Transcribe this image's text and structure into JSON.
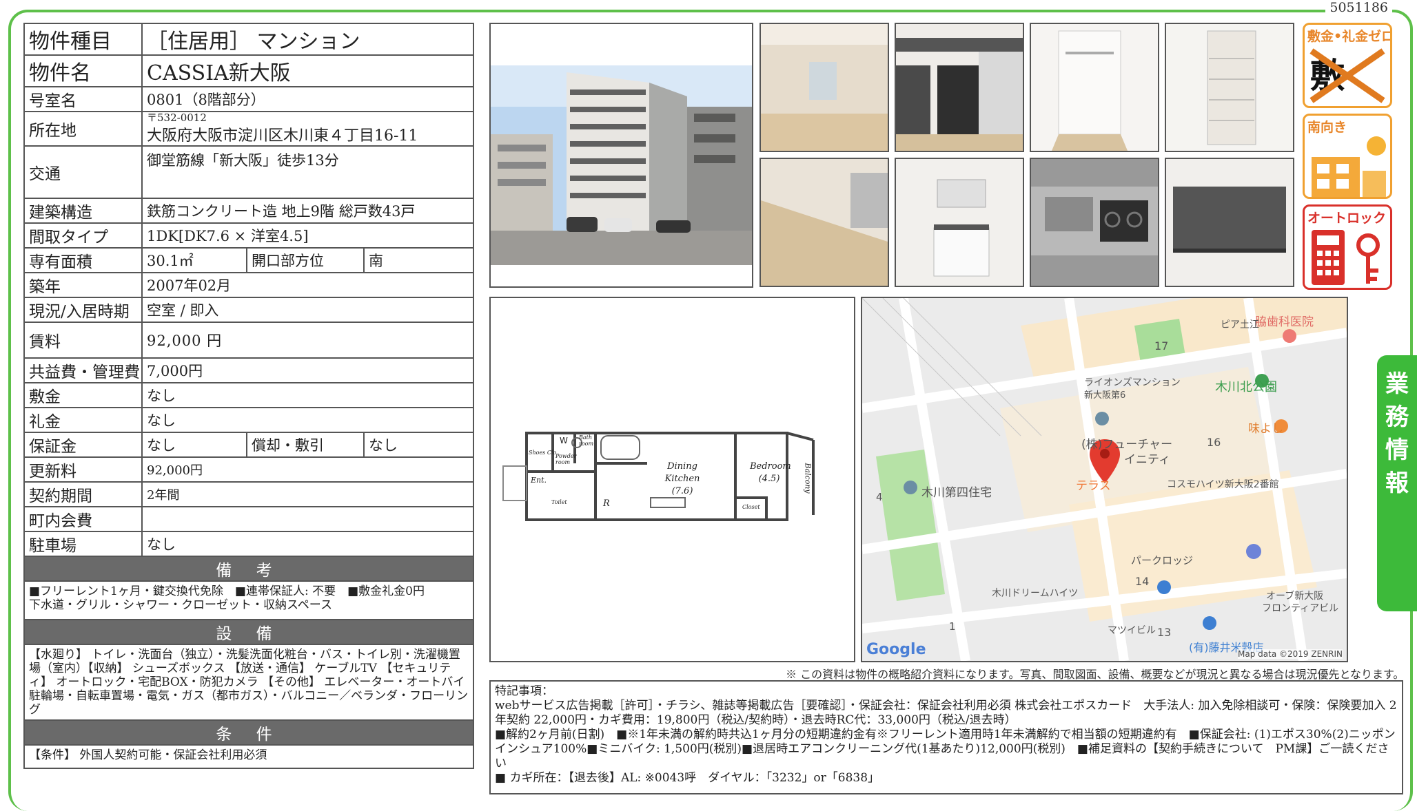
{
  "doc_id": "5051186",
  "spec": {
    "type_label": "物件種目",
    "type_value": "［住居用］ マンション",
    "name_label": "物件名",
    "name_value": "CASSIA新大阪",
    "room_label": "号室名",
    "room_value": "0801（8階部分）",
    "loc_label": "所在地",
    "zip": "〒532-0012",
    "address": "大阪府大阪市淀川区木川東４丁目16-11",
    "access_label": "交通",
    "access_value": "御堂筋線「新大阪」徒歩13分",
    "struct_label": "建築構造",
    "struct_value": "鉄筋コンクリート造 地上9階 総戸数43戸",
    "layout_label": "間取タイプ",
    "layout_value": "1DK[DK7.6 × 洋室4.5]",
    "area_label": "専有面積",
    "area_value": "30.1㎡",
    "dir_label": "開口部方位",
    "dir_value": "南",
    "year_label": "築年",
    "year_value": "2007年02月",
    "status_label": "現況/入居時期",
    "status_value": "空室 / 即入",
    "rent_label": "賃料",
    "rent_value": "92,000 円",
    "fee_label": "共益費・管理費",
    "fee_value": "7,000円",
    "deposit_label": "敷金",
    "deposit_value": "なし",
    "key_label": "礼金",
    "key_value": "なし",
    "guarantee_label": "保証金",
    "guarantee_value": "なし",
    "amort_label": "償却・敷引",
    "amort_value": "なし",
    "renew_label": "更新料",
    "renew_value": "92,000円",
    "term_label": "契約期間",
    "term_value": "2年間",
    "town_label": "町内会費",
    "town_value": "",
    "parking_label": "駐車場",
    "parking_value": "なし"
  },
  "remarks_header": "備 考",
  "remarks_body": "■フリーレント1ヶ月・鍵交換代免除　■連帯保証人: 不要　■敷金礼金0円\n下水道・グリル・シャワー・クローゼット・収納スペース",
  "equip_header": "設 備",
  "equip_body": "【水廻り】 トイレ・洗面台（独立）・洗髪洗面化粧台・バス・トイレ別・洗濯機置場（室内）【収納】 シューズボックス 【放送・通信】 ケーブルTV 【セキュリティ】 オートロック・宅配BOX・防犯カメラ 【その他】 エレベーター・オートバイ駐輪場・自転車置場・電気・ガス（都市ガス）・バルコニー／ベランダ・フローリング",
  "cond_header": "条 件",
  "cond_body": "【条件】 外国人契約可能・保証会社利用必須",
  "badges": {
    "b1": "敷金•礼金ゼロ",
    "b1_mark": "敷 礼",
    "b2": "南向き",
    "b3": "オートロック"
  },
  "green_tab": [
    "業",
    "務",
    "情",
    "報"
  ],
  "floorplan": {
    "w": "W",
    "bath": "Bath room",
    "powder": "Powder room",
    "shoes": "Shoes Clo.",
    "ent": "Ent.",
    "toilet": "Toilet",
    "r": "R",
    "dk": "Dining Kitchen (7.6)",
    "bed": "Bedroom (4.5)",
    "balcony": "Balcony",
    "closet": "Closet"
  },
  "map": {
    "labels": [
      "脇歯科医院",
      "ピア土江",
      "17",
      "ライオンズマンション",
      "新大阪第6",
      "木川北公園",
      "味よし",
      "(株)フューチャー",
      "イニティ",
      "16",
      "テラス",
      "コスモハイツ新大阪2番館",
      "木川第四住宅",
      "4",
      "パークロッジ",
      "14",
      "木川ドリームハイツ",
      "オーブ新大阪",
      "フロンティアビル",
      "1",
      "マツイビル",
      "13",
      "(有)藤井米穀店"
    ],
    "google": "Google",
    "attribution": "Map data ©2019 ZENRIN"
  },
  "notice": "※ この資料は物件の概略紹介資料になります。写真、間取図面、設備、概要などが現況と異なる場合は現況優先となります。",
  "special": [
    "特記事項：",
    "webサービス広告掲載［許可］・チラシ、雑誌等掲載広告［要確認］・保証会社：保証会社利用必須 株式会社エポスカード　大手法人: 加入免除相談可・保険：保険要加入 2年契約 22,000円・カギ費用：19,800円（税込/契約時）・退去時RC代：33,000円（税込/退去時）",
    "■解約2ヶ月前(日割)　■※1年未満の解約時共込1ヶ月分の短期違約金有※フリーレント適用時1年未満解約で相当額の短期違約有　■保証会社: (1)エポス30%(2)ニッポンインシュア100%■ミニバイク: 1,500円(税別)■退居時エアコンクリーニング代(1基あたり)12,000円(税別)　■補足資料の【契約手続きについて　PM課】ご一読ください",
    "■ カギ所在：【退去後】AL: ※0043呼　ダイヤル：「3232」or「6838」"
  ]
}
